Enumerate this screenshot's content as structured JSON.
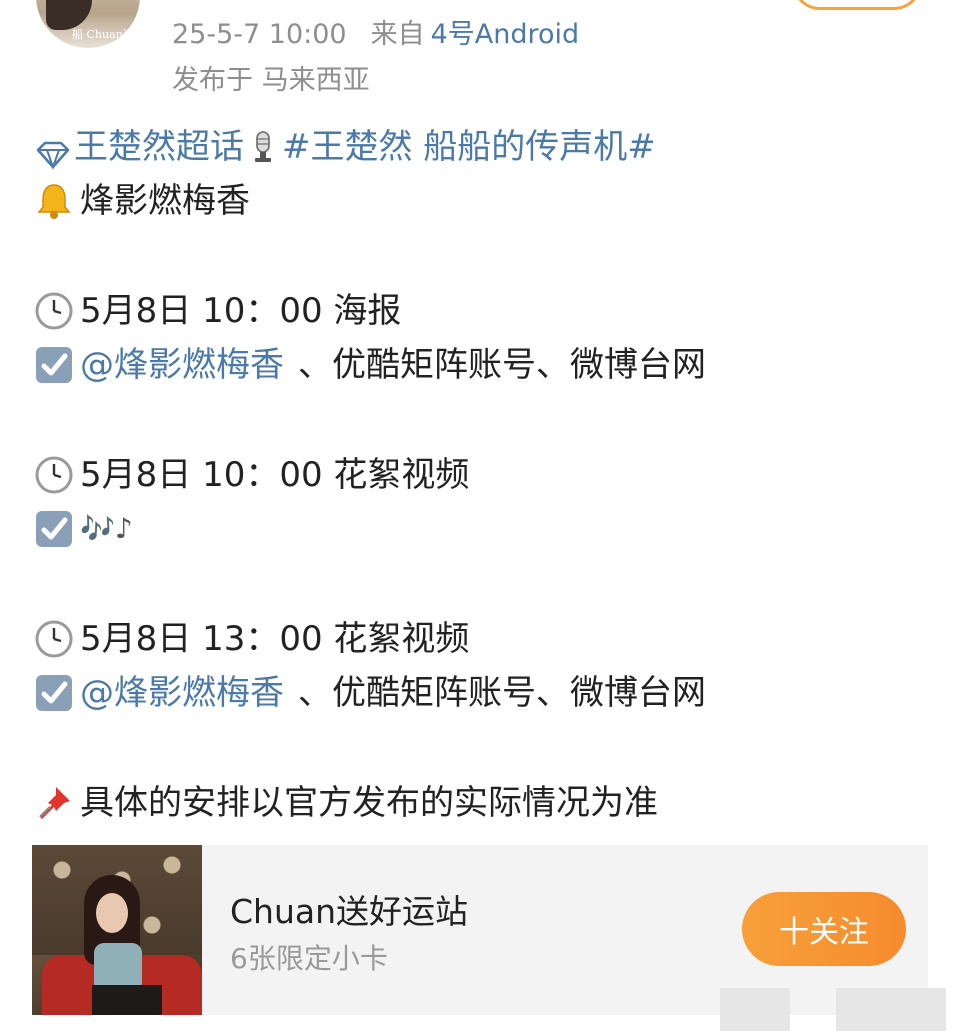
{
  "header": {
    "avatar_text": "船 Chuan送",
    "timestamp": "25-5-7 10:00",
    "source_label": "来自",
    "device": "4号Android",
    "location": "发布于 马来西亚"
  },
  "post": {
    "supertopic": "王楚然超话",
    "hashtag": "#王楚然 船船的传声机#",
    "title": "烽影燃梅香",
    "items": [
      {
        "time": "5月8日 10：00 海报",
        "mention": "@烽影燃梅香",
        "rest": "、优酷矩阵账号、微博台网"
      },
      {
        "time": "5月8日 10：00 花絮视频",
        "notes": "🎶♪"
      },
      {
        "time": "5月8日 13：00 花絮视频",
        "mention": "@烽影燃梅香",
        "rest": "、优酷矩阵账号、微博台网"
      }
    ],
    "note": "具体的安排以官方发布的实际情况为准"
  },
  "card": {
    "title": "Chuan送好运站",
    "subtitle": "6张限定小卡",
    "follow_label": "十关注"
  },
  "icons": {
    "supertopic": "diamond-icon",
    "hashtag": "microphone-icon",
    "title": "bell-icon",
    "time": "clock-icon",
    "check": "checkbox-icon",
    "note": "pushpin-icon"
  },
  "colors": {
    "link": "#4c7aa8",
    "meta": "#8e8e8e",
    "follow": "#f68b2e",
    "check": "#8aa0b8"
  }
}
